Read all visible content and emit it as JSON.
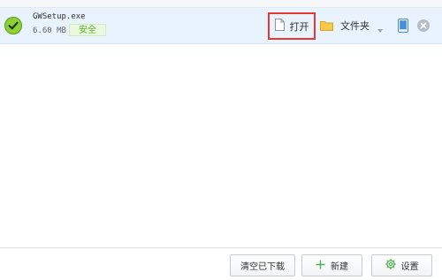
{
  "download": {
    "file_name": "GWSetup.exe",
    "file_size": "6.60 MB",
    "safety_label": "安全",
    "open_label": "打开",
    "folder_label": "文件夹"
  },
  "footer": {
    "clear_label": "清空已下载",
    "new_label": "新建",
    "settings_label": "设置"
  },
  "colors": {
    "row_highlight": "#e8f3fd",
    "check_green": "#8dcf35",
    "safe_green": "#5eae2e",
    "highlight_red": "#e53935",
    "folder_yellow": "#f7c948",
    "phone_blue": "#4a90d9"
  },
  "icons": {
    "status": "check-icon",
    "open": "document-icon",
    "folder": "folder-icon",
    "more": "chevron-down-icon",
    "send_to_phone": "phone-icon",
    "remove": "close-icon",
    "new": "plus-icon",
    "settings": "gear-icon"
  }
}
